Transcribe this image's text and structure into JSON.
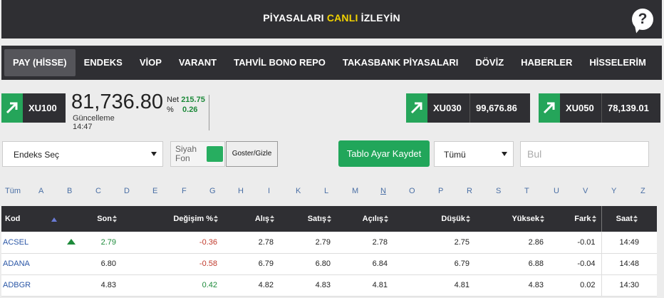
{
  "header": {
    "title_pre": "PİYASALARI ",
    "title_hl": "CANLI",
    "title_post": " İZLEYİN",
    "help": "?"
  },
  "nav": {
    "tabs": [
      "PAY (HİSSE)",
      "ENDEKS",
      "VİOP",
      "VARANT",
      "TAHVİL BONO REPO",
      "TAKASBANK PİYASALARI",
      "DÖVİZ",
      "HABERLER",
      "HİSSELERİM"
    ]
  },
  "main_index": {
    "name": "XU100",
    "value": "81,736.80",
    "net_label": "Net",
    "net_value": "215.75",
    "pct_label": "%",
    "pct_value": "0.26",
    "update_label": "Güncelleme",
    "update_time": "14:47"
  },
  "index_cards": [
    {
      "name": "XU030",
      "value": "99,676.86"
    },
    {
      "name": "XU050",
      "value": "78,139.01"
    }
  ],
  "controls": {
    "endeks_select": "Endeks Seç",
    "siyah_fon": "Siyah\nFon",
    "siyah_fon_1": "Siyah",
    "siyah_fon_2": "Fon",
    "goster_gizle": "Goster/Gizle",
    "tablo_kaydet": "Tablo Ayar Kaydet",
    "tumu_select": "Tümü",
    "search_placeholder": "Bul"
  },
  "letters": [
    "Tüm",
    "A",
    "B",
    "C",
    "D",
    "E",
    "F",
    "G",
    "H",
    "I",
    "K",
    "L",
    "M",
    "N",
    "O",
    "P",
    "R",
    "S",
    "T",
    "U",
    "V",
    "Y",
    "Z"
  ],
  "table": {
    "headers": [
      "Kod",
      "Son",
      "Değişim %",
      "Alış",
      "Satış",
      "Açılış",
      "Düşük",
      "Yüksek",
      "Fark",
      "Saat"
    ],
    "rows": [
      {
        "kod": "ACSEL",
        "trend": "up",
        "son": "2.79",
        "degisim": "-0.36",
        "alis": "2.78",
        "satis": "2.79",
        "acilis": "2.78",
        "dusuk": "2.75",
        "yuksek": "2.86",
        "fark": "-0.01",
        "saat": "14:49"
      },
      {
        "kod": "ADANA",
        "trend": "",
        "son": "6.80",
        "degisim": "-0.58",
        "alis": "6.79",
        "satis": "6.80",
        "acilis": "6.84",
        "dusuk": "6.79",
        "yuksek": "6.88",
        "fark": "-0.04",
        "saat": "14:48"
      },
      {
        "kod": "ADBGR",
        "trend": "",
        "son": "4.83",
        "degisim": "0.42",
        "alis": "4.82",
        "satis": "4.83",
        "acilis": "4.81",
        "dusuk": "4.81",
        "yuksek": "4.83",
        "fark": "0.02",
        "saat": "14:30"
      }
    ]
  },
  "colors": {
    "dark": "#2f2f33",
    "green": "#25a55a",
    "positive": "#1d8a3a",
    "negative": "#c0392b",
    "link": "#2a56a6"
  }
}
